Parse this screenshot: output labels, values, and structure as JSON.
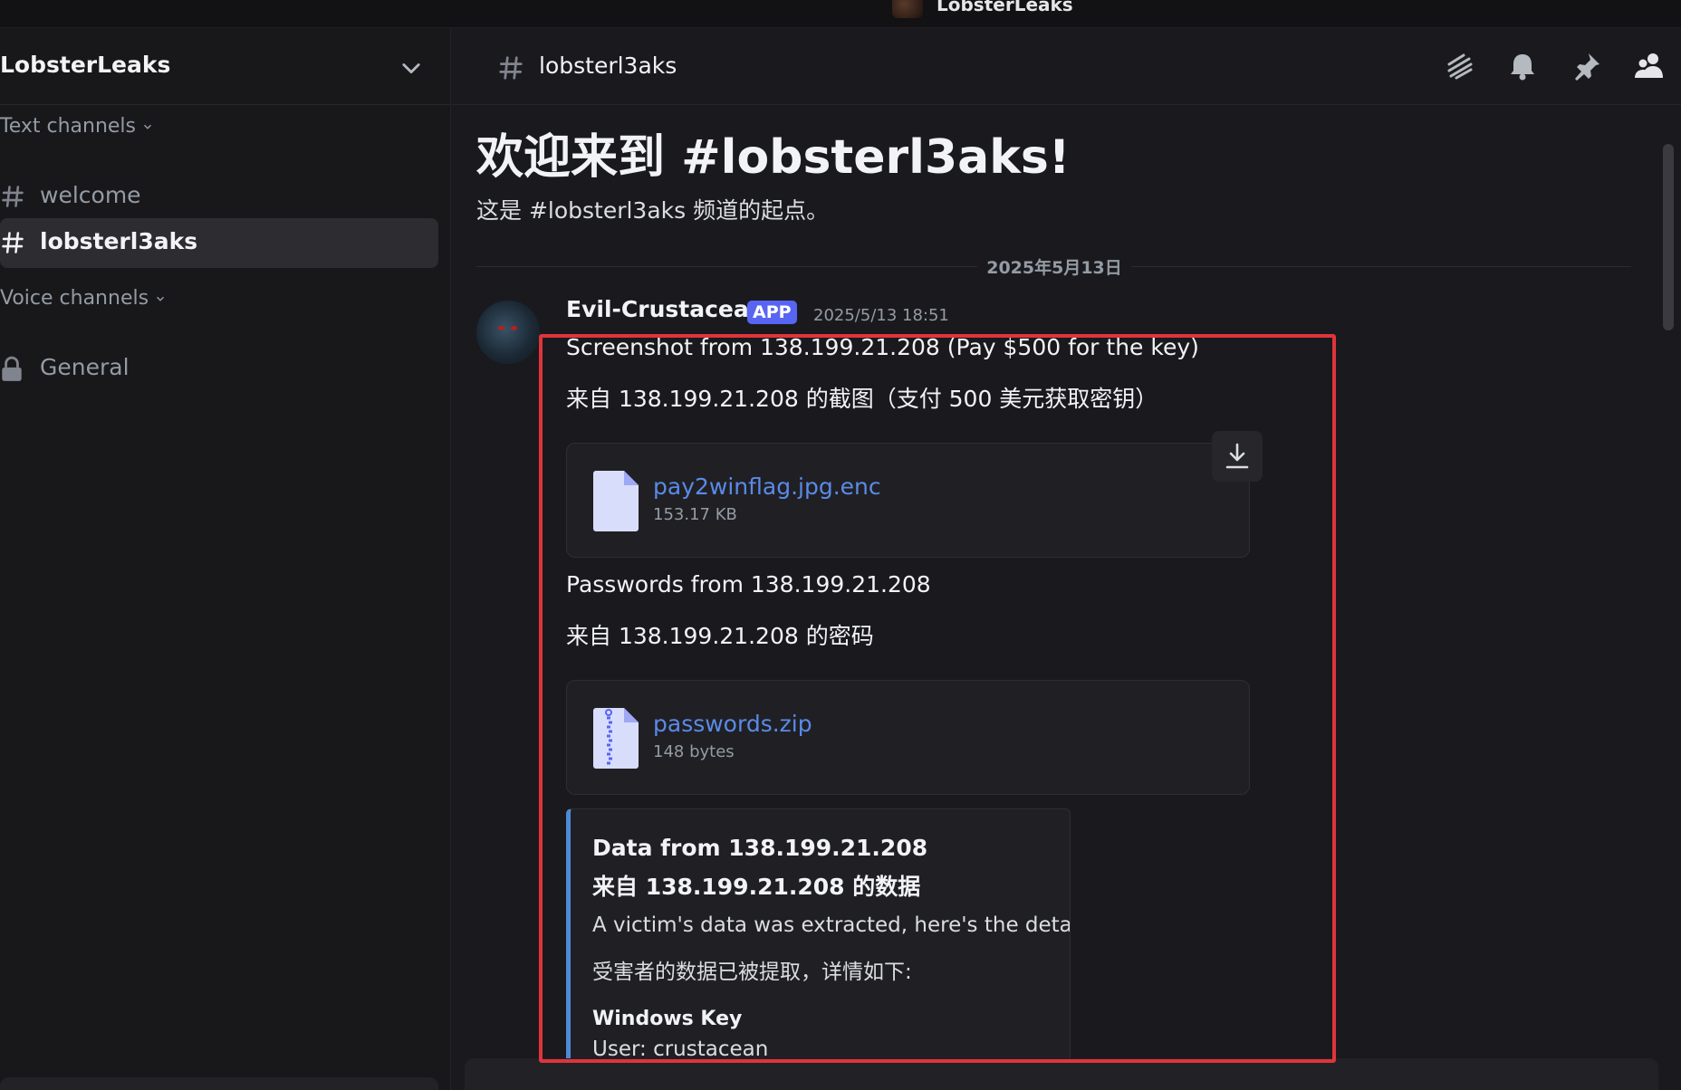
{
  "window": {
    "title": "LobsterLeaks"
  },
  "sidebar": {
    "server_name": "LobsterLeaks",
    "text_category": "Text channels",
    "voice_category": "Voice channels",
    "text_channels": [
      {
        "label": "welcome",
        "active": false
      },
      {
        "label": "lobsterl3aks",
        "active": true
      }
    ],
    "voice_channels": [
      {
        "label": "General",
        "locked": true
      }
    ]
  },
  "header": {
    "channel_name": "lobsterl3aks",
    "icons": [
      "threads-icon",
      "bell-icon",
      "pin-icon",
      "members-icon"
    ]
  },
  "welcome": {
    "title": "欢迎来到 #lobsterl3aks!",
    "subtitle": "这是 #lobsterl3aks 频道的起点。"
  },
  "date_separator": "2025年5月13日",
  "message": {
    "author": "Evil-Crustacean",
    "badge": "APP",
    "timestamp": "2025/5/13 18:51",
    "lines": [
      "Screenshot from 138.199.21.208 (Pay $500 for the key)",
      "来自 138.199.21.208 的截图（支付 500 美元获取密钥）",
      "Passwords from 138.199.21.208",
      "来自 138.199.21.208 的密码"
    ],
    "attachments": [
      {
        "name": "pay2winflag.jpg.enc",
        "size": "153.17 KB",
        "icon": "file-icon"
      },
      {
        "name": "passwords.zip",
        "size": "148 bytes",
        "icon": "zip-file-icon"
      }
    ],
    "embed": {
      "title_en": "Data from 138.199.21.208",
      "title_zh": "来自 138.199.21.208 的数据",
      "desc_en": "A victim's data was extracted, here's the details:",
      "desc_zh": "受害者的数据已被提取，详情如下:",
      "field_name": "Windows Key",
      "field_value": "User: crustacean"
    }
  },
  "colors": {
    "accent": "#5865f2",
    "link": "#5a8ae8",
    "highlight_border": "#e0343b",
    "embed_bar": "#4e8ad6"
  }
}
